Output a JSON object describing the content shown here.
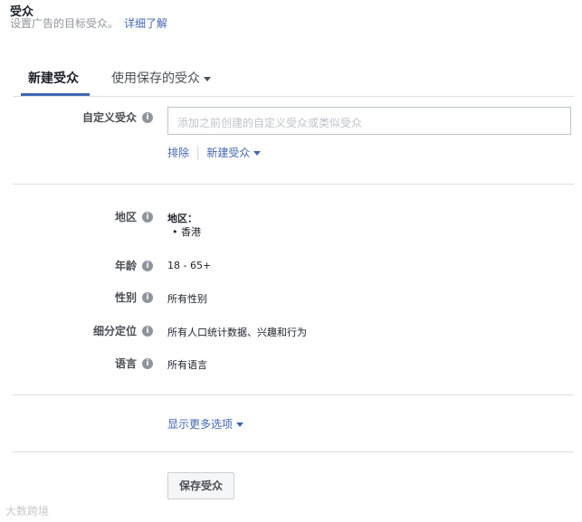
{
  "header": {
    "title": "受众",
    "subtitle": "设置广告的目标受众。",
    "learn_more": "详细了解"
  },
  "tabs": [
    {
      "label": "新建受众"
    },
    {
      "label": "使用保存的受众"
    }
  ],
  "custom_audience": {
    "label": "自定义受众",
    "placeholder": "添加之前创建的自定义受众或类似受众",
    "exclude": "排除",
    "create_new": "新建受众"
  },
  "rows": {
    "location": {
      "label": "地区",
      "heading": "地区：",
      "value": "香港"
    },
    "age": {
      "label": "年龄",
      "value": "18 - 65+"
    },
    "gender": {
      "label": "性别",
      "value": "所有性别"
    },
    "targeting": {
      "label": "细分定位",
      "value": "所有人口统计数据、兴趣和行为"
    },
    "language": {
      "label": "语言",
      "value": "所有语言"
    }
  },
  "more_options": "显示更多选项",
  "save_button": "保存受众",
  "watermark": "大数跨境"
}
